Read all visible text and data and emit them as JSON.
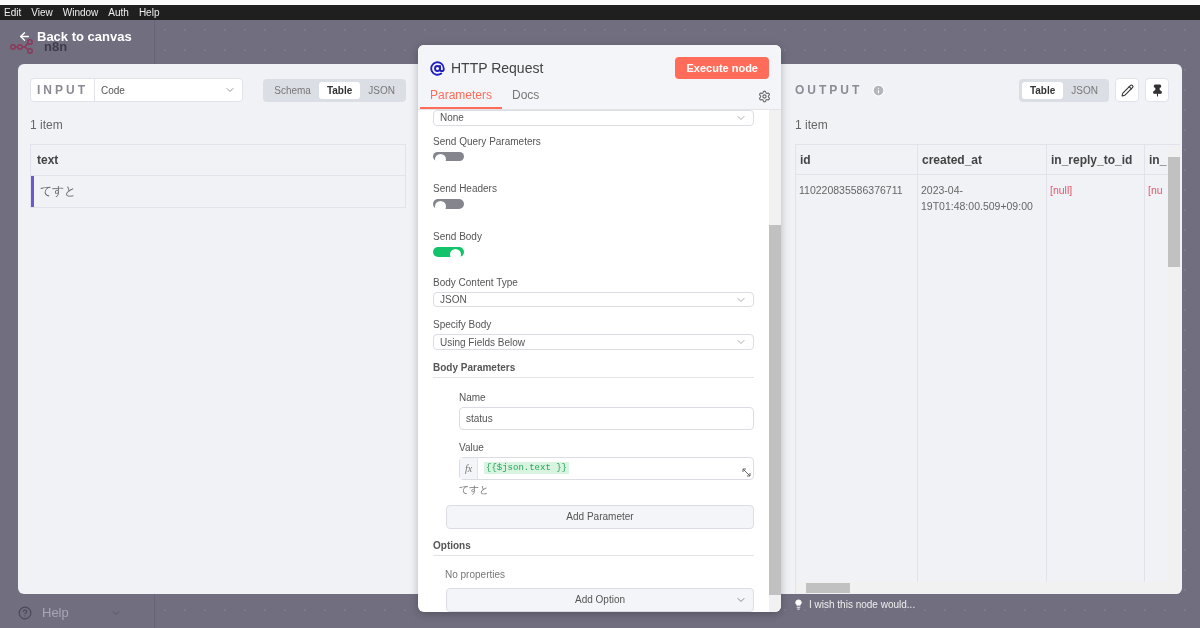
{
  "menu_bar": {
    "items": [
      "Edit",
      "View",
      "Window",
      "Auth",
      "Help"
    ]
  },
  "sidebar": {
    "logo": "n8n",
    "help": "Help"
  },
  "back_link": "Back to canvas",
  "input": {
    "label": "INPUT",
    "source": "Code",
    "views": [
      {
        "label": "Schema",
        "selected": false
      },
      {
        "label": "Table",
        "selected": true
      },
      {
        "label": "JSON",
        "selected": false
      }
    ],
    "count": "1 item",
    "table": {
      "columns": [
        "text"
      ],
      "rows": [
        [
          "てすと"
        ]
      ]
    }
  },
  "node": {
    "title": "HTTP Request",
    "execute_button": "Execute node",
    "tabs": [
      {
        "label": "Parameters",
        "selected": true
      },
      {
        "label": "Docs",
        "selected": false
      }
    ],
    "top_select": "None",
    "toggles": [
      {
        "label": "Send Query Parameters",
        "on": false
      },
      {
        "label": "Send Headers",
        "on": false
      },
      {
        "label": "Send Body",
        "on": true
      }
    ],
    "selects": [
      {
        "label": "Body Content Type",
        "value": "JSON"
      },
      {
        "label": "Specify Body",
        "value": "Using Fields Below"
      }
    ],
    "body_parameters": {
      "title": "Body Parameters",
      "name_label": "Name",
      "name_value": "status",
      "value_label": "Value",
      "expression_prefix": "fx",
      "expression": "{{$json.text }}",
      "preview": "てすと",
      "add_button": "Add Parameter"
    },
    "options": {
      "title": "Options",
      "empty": "No properties",
      "add_button": "Add Option"
    }
  },
  "output": {
    "label": "OUTPUT",
    "views": [
      {
        "label": "Table",
        "selected": true
      },
      {
        "label": "JSON",
        "selected": false
      }
    ],
    "count": "1 item",
    "table": {
      "columns": [
        "id",
        "created_at",
        "in_reply_to_id",
        "in_"
      ],
      "rows": [
        [
          {
            "kind": "text",
            "text": "110220835586376711"
          },
          {
            "kind": "text",
            "text": "2023-04-19T01:48:00.509+09:00"
          },
          {
            "kind": "null",
            "text": "[null]"
          },
          {
            "kind": "null",
            "text": "[nu"
          }
        ]
      ]
    }
  },
  "feedback": "I wish this node would..."
}
